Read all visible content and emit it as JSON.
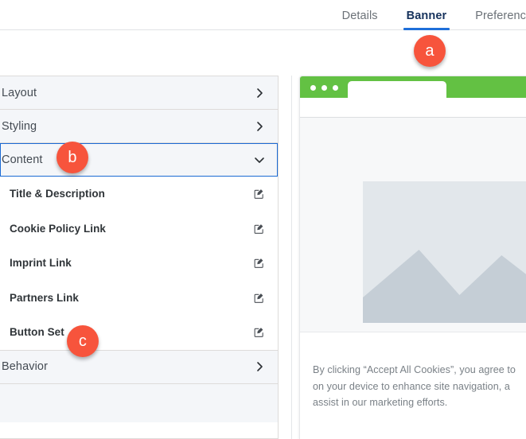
{
  "tabs": [
    {
      "label": "Details",
      "active": false
    },
    {
      "label": "Banner",
      "active": true
    },
    {
      "label": "Preferenc",
      "active": false
    }
  ],
  "sidebar": {
    "sections": [
      {
        "label": "Layout",
        "state": "collapsed",
        "icon": "chevron-right-icon"
      },
      {
        "label": "Styling",
        "state": "collapsed",
        "icon": "chevron-right-icon"
      },
      {
        "label": "Content",
        "state": "expanded",
        "icon": "chevron-down-icon"
      },
      {
        "label": "Behavior",
        "state": "collapsed",
        "icon": "chevron-right-icon"
      }
    ],
    "content_items": [
      {
        "label": "Title & Description",
        "action_icon": "edit-pencil-icon"
      },
      {
        "label": "Cookie Policy Link",
        "action_icon": "edit-pencil-icon"
      },
      {
        "label": "Imprint Link",
        "action_icon": "edit-pencil-icon"
      },
      {
        "label": "Partners Link",
        "action_icon": "edit-pencil-icon"
      },
      {
        "label": "Button Set",
        "action_icon": "edit-pencil-icon"
      }
    ]
  },
  "preview": {
    "browser": {
      "chrome_color": "#63c143",
      "dots": 3
    },
    "cookie_banner": {
      "text": "By clicking “Accept All Cookies”, you agree to\non your device to enhance site navigation, a\nassist in our marketing efforts."
    }
  },
  "annotations": [
    {
      "id": "a",
      "label": "a",
      "target": "banner-tab"
    },
    {
      "id": "b",
      "label": "b",
      "target": "content-section"
    },
    {
      "id": "c",
      "label": "c",
      "target": "button-set-item"
    }
  ],
  "colors": {
    "accent_blue": "#1b6ad4",
    "badge_red": "#f7543c",
    "browser_green": "#63c143"
  }
}
